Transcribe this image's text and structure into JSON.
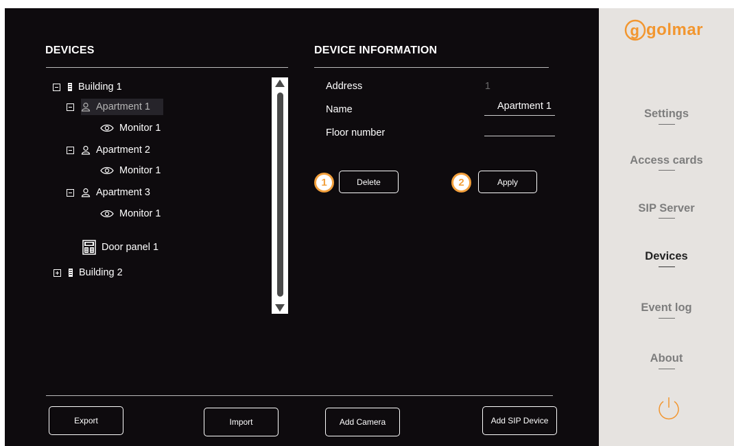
{
  "devices_panel": {
    "title": "DEVICES",
    "tree": [
      {
        "label": "Building 1",
        "toggle": "collapse",
        "icon": "building-icon"
      },
      {
        "label": "Apartment 1",
        "toggle": "collapse",
        "icon": "person-icon",
        "selected": true
      },
      {
        "label": "Monitor 1",
        "icon": "eye-icon"
      },
      {
        "label": "Apartment 2",
        "toggle": "collapse",
        "icon": "person-icon"
      },
      {
        "label": "Monitor 1",
        "icon": "eye-icon"
      },
      {
        "label": "Apartment 3",
        "toggle": "collapse",
        "icon": "person-icon"
      },
      {
        "label": "Monitor 1",
        "icon": "eye-icon"
      },
      {
        "label": "Door panel 1",
        "icon": "door-panel-icon"
      },
      {
        "label": "Building 2",
        "toggle": "expand",
        "icon": "building-icon"
      }
    ]
  },
  "info_panel": {
    "title": "DEVICE INFORMATION",
    "address_label": "Address",
    "address_value": "1",
    "name_label": "Name",
    "name_value": "Apartment 1",
    "floor_label": "Floor number",
    "floor_value": "",
    "delete_label": "Delete",
    "apply_label": "Apply",
    "badge_1": "1",
    "badge_2": "2"
  },
  "bottom_buttons": {
    "export": "Export",
    "import": "Import",
    "add_camera": "Add Camera",
    "add_sip_device": "Add SIP Device"
  },
  "sidebar": {
    "logo": "golmar",
    "items": [
      {
        "label": "Settings",
        "active": false
      },
      {
        "label": "Access cards",
        "active": false
      },
      {
        "label": "SIP Server",
        "active": false
      },
      {
        "label": "Devices",
        "active": true
      },
      {
        "label": "Event log",
        "active": false
      },
      {
        "label": "About",
        "active": false
      }
    ],
    "power_icon": "power-icon"
  },
  "colors": {
    "screen_bg": "#0e0b0e",
    "sidebar_bg": "#e6e3e0",
    "accent_orange": "#f2962f"
  }
}
